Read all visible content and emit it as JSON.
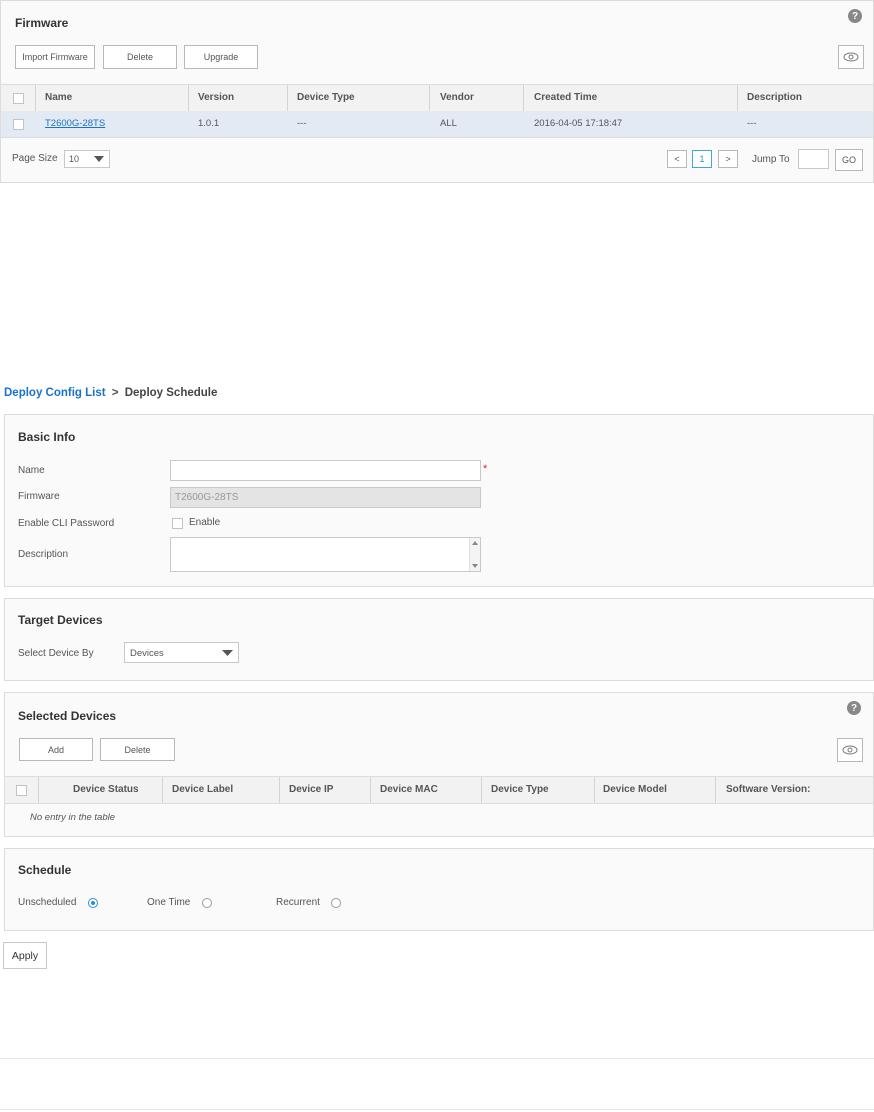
{
  "firmware": {
    "title": "Firmware",
    "help_label": "?",
    "buttons": {
      "import": "Import Firmware",
      "delete": "Delete",
      "upgrade": "Upgrade"
    },
    "columns": [
      "Name",
      "Version",
      "Device Type",
      "Vendor",
      "Created Time",
      "Description"
    ],
    "rows": [
      {
        "name": "T2600G-28TS",
        "version": "1.0.1",
        "device_type": "---",
        "vendor": "ALL",
        "created_time": "2016-04-05 17:18:47",
        "description": "---"
      }
    ],
    "pagination": {
      "page_size_label": "Page Size",
      "page_size_value": "10",
      "prev": "<",
      "current_page": "1",
      "next": ">",
      "jump_to_label": "Jump To",
      "go": "GO"
    }
  },
  "breadcrumb": {
    "link": "Deploy Config List",
    "separator": ">",
    "current": "Deploy Schedule"
  },
  "basic_info": {
    "title": "Basic Info",
    "name_label": "Name",
    "name_value": "",
    "required_mark": "*",
    "firmware_label": "Firmware",
    "firmware_value": "T2600G-28TS",
    "cli_label": "Enable CLI Password",
    "cli_checkbox_label": "Enable",
    "description_label": "Description",
    "description_value": ""
  },
  "target_devices": {
    "title": "Target Devices",
    "select_label": "Select Device By",
    "select_value": "Devices"
  },
  "selected_devices": {
    "title": "Selected Devices",
    "help_label": "?",
    "buttons": {
      "add": "Add",
      "delete": "Delete"
    },
    "columns": [
      "Device Status",
      "Device Label",
      "Device IP",
      "Device MAC",
      "Device Type",
      "Device Model",
      "Software Version:"
    ],
    "empty_text": "No entry in the table"
  },
  "schedule": {
    "title": "Schedule",
    "options": [
      {
        "label": "Unscheduled",
        "selected": true
      },
      {
        "label": "One Time",
        "selected": false
      },
      {
        "label": "Recurrent",
        "selected": false
      }
    ]
  },
  "apply_label": "Apply",
  "colors": {
    "accent": "#2a8fd6",
    "link": "#1a73c8",
    "row_selected": "#e3eaf3",
    "required": "#e02020",
    "pager_active": "#44a8c8"
  }
}
